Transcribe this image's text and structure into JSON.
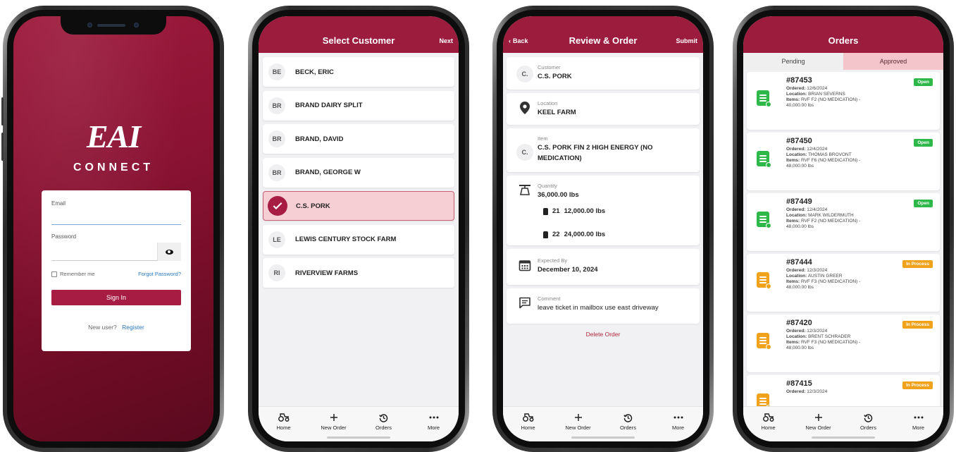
{
  "colors": {
    "brand": "#9c1c3e",
    "accent_link": "#2a78c2",
    "status_open": "#2eb84a",
    "status_in_process": "#f0a21a",
    "selected_row": "#f6cfd5"
  },
  "login": {
    "logo": "EAI",
    "logo_sub": "CONNECT",
    "email_label": "Email",
    "email_value": "",
    "password_label": "Password",
    "password_value": "",
    "remember_label": "Remember me",
    "forgot_label": "Forgot Password?",
    "sign_in_label": "Sign In",
    "new_user_text": "New user?",
    "register_label": "Register"
  },
  "select_customer": {
    "title": "Select Customer",
    "next_label": "Next",
    "customers": [
      {
        "initials": "BE",
        "name": "BECK, ERIC",
        "selected": false
      },
      {
        "initials": "BR",
        "name": "BRAND DAIRY SPLIT",
        "selected": false
      },
      {
        "initials": "BR",
        "name": "BRAND, DAVID",
        "selected": false
      },
      {
        "initials": "BR",
        "name": "BRAND, GEORGE W",
        "selected": false
      },
      {
        "initials": "",
        "name": "C.S. PORK",
        "selected": true
      },
      {
        "initials": "LE",
        "name": "LEWIS CENTURY STOCK FARM",
        "selected": false
      },
      {
        "initials": "RI",
        "name": "RIVERVIEW FARMS",
        "selected": false
      }
    ]
  },
  "review": {
    "title": "Review & Order",
    "back_label": "Back",
    "submit_label": "Submit",
    "customer_label": "Customer",
    "customer_initial": "C.",
    "customer_value": "C.S. PORK",
    "location_label": "Location",
    "location_value": "KEEL FARM",
    "item_label": "Item",
    "item_initial": "C.",
    "item_value": "C.S. PORK FIN 2 HIGH ENERGY (NO MEDICATION)",
    "quantity_label": "Quantity",
    "quantity_value": "36,000.00 lbs",
    "bins": [
      {
        "bin": "21",
        "amount": "12,000.00 lbs"
      },
      {
        "bin": "22",
        "amount": "24,000.00 lbs"
      }
    ],
    "expected_label": "Expected By",
    "expected_value": "December 10, 2024",
    "comment_label": "Comment",
    "comment_value": "leave ticket in mailbox use east driveway",
    "delete_label": "Delete Order"
  },
  "orders": {
    "title": "Orders",
    "tabs": [
      {
        "label": "Pending",
        "active": false
      },
      {
        "label": "Approved",
        "active": true
      }
    ],
    "ordered_key": "Ordered:",
    "location_key": "Location:",
    "items_key": "Items:",
    "list": [
      {
        "number": "#87453",
        "ordered": "12/6/2024",
        "location": "BRIAN SEVERNS",
        "items": "RVF F2 (NO MEDICATION) - 40,000.00 lbs",
        "status": "Open",
        "status_kind": "open"
      },
      {
        "number": "#87450",
        "ordered": "12/4/2024",
        "location": "THOMAS BROVONT",
        "items": "RVF F6 (NO MEDICATION) - 48,000.00 lbs",
        "status": "Open",
        "status_kind": "open"
      },
      {
        "number": "#87449",
        "ordered": "12/4/2024",
        "location": "MARK WILDERMUTH",
        "items": "RVF F2 (NO MEDICATION) - 48,000.00 lbs",
        "status": "Open",
        "status_kind": "open"
      },
      {
        "number": "#87444",
        "ordered": "12/3/2024",
        "location": "AUSTIN GREER",
        "items": "RVF F3 (NO MEDICATION) - 48,000.00 lbs",
        "status": "In Process",
        "status_kind": "process"
      },
      {
        "number": "#87420",
        "ordered": "12/3/2024",
        "location": "BRENT SCHRADER",
        "items": "RVF F3 (NO MEDICATION) - 48,000.00 lbs",
        "status": "In Process",
        "status_kind": "process"
      },
      {
        "number": "#87415",
        "ordered": "12/3/2024",
        "location": "",
        "items": "",
        "status": "In Process",
        "status_kind": "process"
      }
    ]
  },
  "nav": {
    "items": [
      {
        "label": "Home",
        "icon": "tractor-icon"
      },
      {
        "label": "New Order",
        "icon": "plus-icon"
      },
      {
        "label": "Orders",
        "icon": "history-icon"
      },
      {
        "label": "More",
        "icon": "more-icon"
      }
    ]
  }
}
